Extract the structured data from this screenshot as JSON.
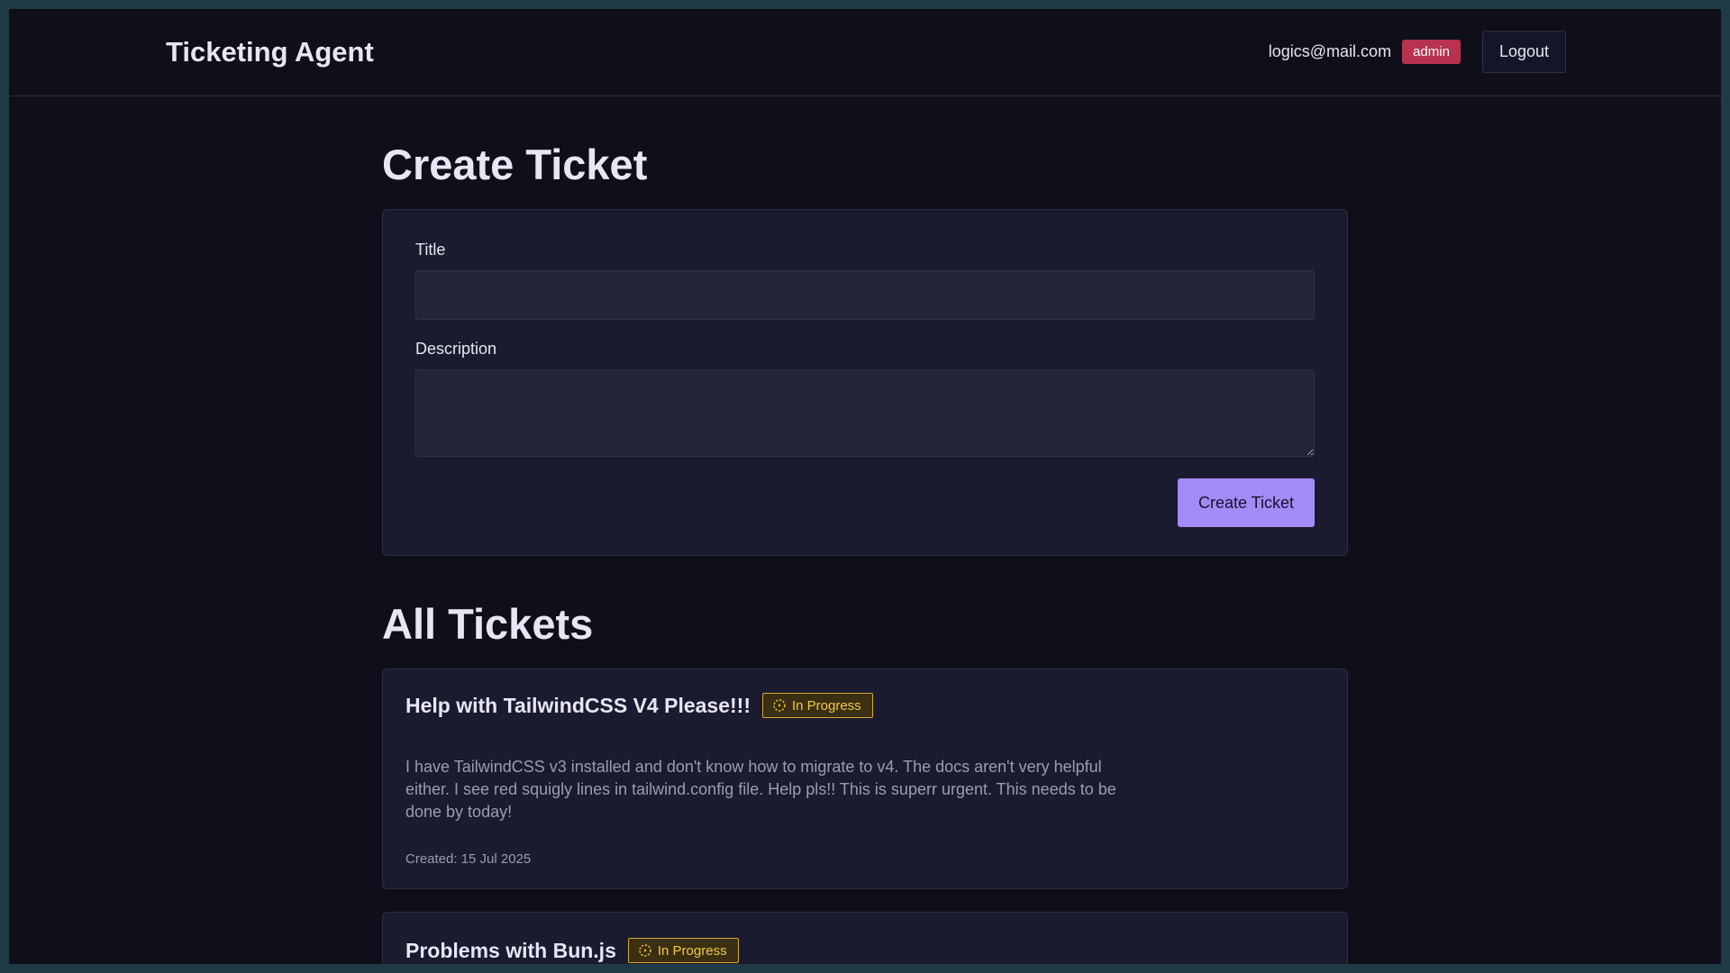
{
  "app": {
    "title": "Ticketing Agent"
  },
  "header": {
    "user_email": "logics@mail.com",
    "role_badge": "admin",
    "logout_label": "Logout"
  },
  "create_section": {
    "heading": "Create Ticket",
    "title_label": "Title",
    "title_value": "",
    "description_label": "Description",
    "description_value": "",
    "submit_label": "Create Ticket"
  },
  "tickets_section": {
    "heading": "All Tickets",
    "tickets": [
      {
        "title": "Help with TailwindCSS V4 Please!!!",
        "status": "In Progress",
        "status_icon": "progress-dashed-circle-icon",
        "description": "I have TailwindCSS v3 installed and don't know how to migrate to v4. The docs aren't very helpful either. I see red squigly lines in tailwind.config file. Help pls!! This is superr urgent. This needs to be done by today!",
        "created": "Created: 15 Jul 2025"
      },
      {
        "title": "Problems with Bun.js",
        "status": "In Progress",
        "status_icon": "progress-dashed-circle-icon"
      }
    ]
  },
  "colors": {
    "background": "#0f0f1a",
    "card": "#1a1b2e",
    "accent": "#a48bfa",
    "admin_badge": "#b83250",
    "status_in_progress": "#f3c845"
  }
}
